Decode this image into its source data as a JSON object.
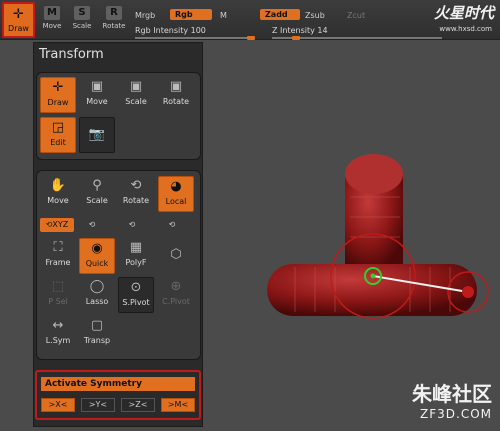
{
  "topbar": {
    "draw": "Draw",
    "tools": [
      {
        "icon": "move-icon",
        "glyph": "M",
        "label": "Move"
      },
      {
        "icon": "scale-icon",
        "glyph": "S",
        "label": "Scale"
      },
      {
        "icon": "rotate-icon",
        "glyph": "R",
        "label": "Rotate"
      }
    ],
    "mrgb": "Mrgb",
    "rgb": "Rgb",
    "m": "M",
    "zadd": "Zadd",
    "zsub": "Zsub",
    "zcut": "Zcut",
    "rgb_intensity": "Rgb Intensity 100",
    "z_intensity": "Z Intensity 14",
    "rgb_intensity_level": 1.0,
    "z_intensity_level": 0.14,
    "logo": "火星时代",
    "logo_url": "www.hxsd.com"
  },
  "panel": {
    "title": "Transform",
    "mode": {
      "draw": "Draw",
      "move": "Move",
      "scale": "Scale",
      "rotate": "Rotate",
      "edit": "Edit"
    },
    "gizmo": {
      "move": "Move",
      "scale": "Scale",
      "rotate": "Rotate",
      "local": "Local",
      "xyz": "XYZ",
      "frame": "Frame",
      "quick": "Quick",
      "polyf": "PolyF",
      "psel": "P Sel",
      "lasso": "Lasso",
      "spivot": "S.Pivot",
      "cpivot": "C.Pivot",
      "lsym": "L.Sym",
      "transp": "Transp"
    }
  },
  "symmetry": {
    "activate": "Activate Symmetry",
    "x": ">X<",
    "y": ">Y<",
    "z": ">Z<",
    "m": ">M<"
  },
  "watermark": {
    "cn": "朱峰社区",
    "en": "ZF3D.COM"
  },
  "colors": {
    "accent": "#e07020",
    "highlight_border": "#c01a1a",
    "mesh": "#8a1616"
  }
}
